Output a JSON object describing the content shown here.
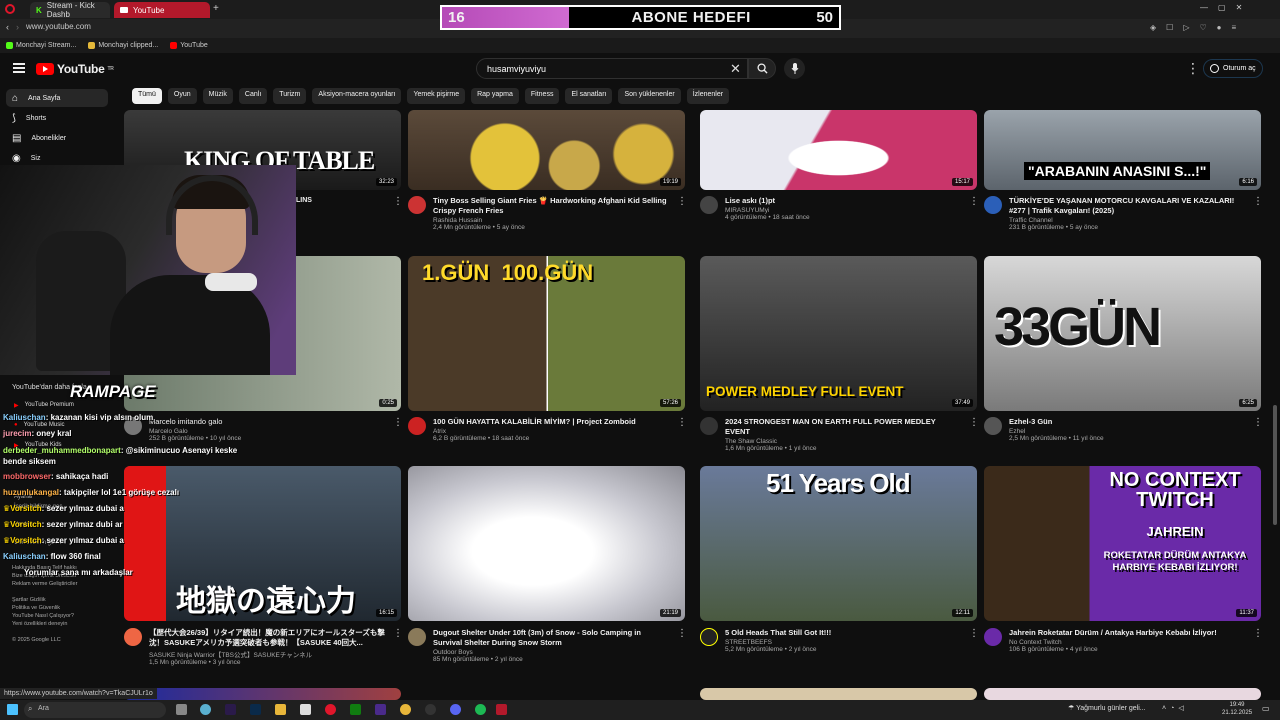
{
  "browser": {
    "tabs": [
      {
        "label": "Stream - Kick Dashb"
      },
      {
        "label": "YouTube"
      }
    ],
    "url": "www.youtube.com",
    "bookmarks": [
      {
        "label": "Monchayi Stream..."
      },
      {
        "label": "Monchayi clipped..."
      },
      {
        "label": "YouTube"
      }
    ]
  },
  "overlay": {
    "current": "16",
    "title": "ABONE HEDEFI",
    "goal": "50",
    "progress": 0.32,
    "brand": "RAMPAGE"
  },
  "header": {
    "logo": "YouTube",
    "logo_sup": "TR",
    "search_value": "husamviyuviyu",
    "signin": "Oturum aç"
  },
  "chips": [
    "Tümü",
    "Oyun",
    "Müzik",
    "Canlı",
    "Turizm",
    "Aksiyon-macera oyunları",
    "Yemek pişirme",
    "Rap yapma",
    "Fitness",
    "El sanatları",
    "Son yüklenenler",
    "İzlenenler"
  ],
  "sidebar": {
    "items": [
      {
        "label": "Ana Sayfa"
      },
      {
        "label": "Shorts"
      },
      {
        "label": "Abonelikler"
      },
      {
        "label": "Siz"
      }
    ],
    "youtube_from": "YouTube'dan daha fazla",
    "more": [
      "YouTube Premium",
      "YouTube Music",
      "YouTube Kids"
    ],
    "footer": [
      "Hakkında",
      "Basın",
      "Telif hakkı",
      "Bize ulaşın",
      "İçerik Üreticiler",
      "Reklam verme",
      "Geliştiriciler",
      "Şartlar",
      "Gizlilik",
      "Politika ve Güvenlik",
      "YouTube Nasıl Çalışıyor?",
      "Yeni özellikleri deneyin",
      "© 2025 Google LLC"
    ],
    "settings": [
      "Ayarlar",
      "İçerik bildirme geç...",
      "Yardım",
      "Geri bildirim gönder"
    ]
  },
  "videos": [
    {
      "title": "KING OF TABLE",
      "thumb_text": "KING OF TABLE",
      "channel": "",
      "meta": "",
      "duration": "32:23"
    },
    {
      "title": "Tiny Boss Selling Giant Fries 🍟 Hardworking Afghani Kid Selling Crispy French Fries",
      "channel": "Rashida Hussain",
      "meta": "2,4 Mn görüntüleme • 5 ay önce",
      "duration": "19:19"
    },
    {
      "title": "Lise askı (1)pt",
      "channel": "MIRASUYUMyi",
      "meta": "4 görüntüleme • 18 saat önce",
      "duration": "15:17"
    },
    {
      "title": "TÜRKİYE'DE YAŞANAN MOTORCU KAVGALARI VE KAZALARI! #277 | Trafik Kavgaları! (2025)",
      "thumb_text": "\"ARABANIN ANASINI S...!\"",
      "channel": "Traffic Channel",
      "meta": "231 B görüntüleme • 5 ay önce",
      "duration": "6:16"
    },
    {
      "title": "Marcelo imitando galo",
      "channel": "Marcelo Galo",
      "meta": "252 B görüntüleme • 10 yıl önce",
      "duration": "0:25"
    },
    {
      "title": "100 GÜN HAYATTA KALABİLİR MİYİM? | Project Zomboid",
      "thumb_text": "1.GÜN  100.GÜN",
      "channel": "Atrix",
      "meta": "6,2 B görüntüleme • 18 saat önce",
      "duration": "57:26"
    },
    {
      "title": "2024 STRONGEST MAN ON EARTH FULL POWER MEDLEY EVENT",
      "thumb_text": "POWER MEDLEY FULL EVENT",
      "channel": "The Shaw Classic",
      "meta": "1,6 Mn görüntüleme • 1 yıl önce",
      "duration": "37:49"
    },
    {
      "title": "Ezhel-3 Gün",
      "thumb_text": "33GÜN",
      "channel": "Ezhel",
      "meta": "2,5 Mn görüntüleme • 11 yıl önce",
      "duration": "6:25"
    },
    {
      "title": "【歴代大会26/39】リタイア続出！魔の新エリアにオールスターズも撃沈！SASUKEアメリカ予選突破者も参戦！【SASUKE 40回大...",
      "thumb_text": "地獄の遠心力",
      "channel": "SASUKE Ninja Warrior【TBS公式】SASUKEチャンネル",
      "meta": "1,5 Mn görüntüleme • 3 yıl önce",
      "duration": "16:15"
    },
    {
      "title": "Dugout Shelter Under 10ft (3m) of Snow - Solo Camping in Survival Shelter During Snow Storm",
      "channel": "Outdoor Boys",
      "meta": "85 Mn görüntüleme • 2 yıl önce",
      "duration": "21:19"
    },
    {
      "title": "5 Old Heads That Still Got It!!!",
      "thumb_text": "51 Years Old",
      "channel": "STREETBEEFS",
      "meta": "5,2 Mn görüntüleme • 2 yıl önce",
      "duration": "12:11"
    },
    {
      "title": "Jahrein Roketatar Dürüm / Antakya Harbiye Kebabı İzliyor!",
      "thumb_text": "NO CONTEXT TWITCH",
      "thumb_sub": "JAHREIN",
      "thumb_sub2": "ROKETATAR DÜRÜM ANTAKYA HARBIYE KEBABI İZLIYOR!",
      "channel": "No Context Twitch",
      "meta": "106 B görüntüleme • 4 yıl önce",
      "duration": "11:37"
    }
  ],
  "chat": [
    {
      "user": "Kaliuschan",
      "msg": "kazanan kisi vip alsın olum"
    },
    {
      "user": "jurecim",
      "msg": "oney kral"
    },
    {
      "user": "derbeder_muhammedbonapart",
      "msg": "@sikiminucuo Asenayi keske bende siksem"
    },
    {
      "user": "mobbrowser",
      "msg": "sahikaça hadi"
    },
    {
      "user": "huzunlukangal",
      "msg": "takipçiler lol 1e1 görüşe cezalı"
    },
    {
      "user": "Vorsitch",
      "msg": "sezer yılmaz dubai a"
    },
    {
      "user": "Vorsitch",
      "msg": "sezer yılmaz dubi ar"
    },
    {
      "user": "Vorsitch",
      "msg": "sezer yılmaz dubai a"
    },
    {
      "user": "Kaliuschan",
      "msg": "flow 360 final"
    },
    {
      "user": "",
      "msg": "Yorumlar sana mı arkadaşlar"
    }
  ],
  "statusbar": {
    "url": "https://www.youtube.com/watch?v=TkaCJULr1o"
  },
  "taskbar": {
    "search": "Ara",
    "weather": "Yağmurlu günler geli...",
    "time": "19:49",
    "date": "21.12.2025"
  }
}
